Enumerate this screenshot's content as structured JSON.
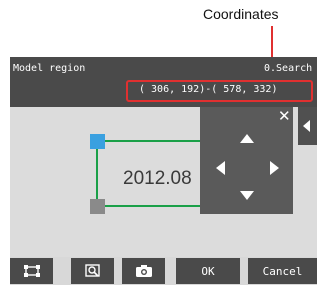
{
  "annotation": {
    "label": "Coordinates",
    "line_color": "#e03030"
  },
  "titlebar": {
    "title": "Model region",
    "mode": "0.Search"
  },
  "coordinates": {
    "text": "( 306, 192)-( 578, 332)",
    "highlight_color": "#e03030"
  },
  "image": {
    "date_text": "2012.08"
  },
  "region": {
    "border_color": "#1aa048",
    "handles": [
      {
        "name": "top-left",
        "color": "#3aa0e0"
      },
      {
        "name": "bottom-left",
        "color": "#8a8a8a"
      },
      {
        "name": "top-right",
        "color": "#333333"
      },
      {
        "name": "bottom-right",
        "color": "#333333"
      }
    ]
  },
  "arrow_panel": {
    "close_symbol": "✕",
    "icons": [
      "close-icon",
      "arrow-up-icon",
      "arrow-down-icon",
      "arrow-left-icon",
      "arrow-right-icon"
    ]
  },
  "side_tab": {
    "icon": "chevron-left-icon"
  },
  "toolbar": {
    "icons": [
      "region-icon",
      "zoom-icon",
      "camera-icon"
    ],
    "ok_label": "OK",
    "cancel_label": "Cancel"
  }
}
